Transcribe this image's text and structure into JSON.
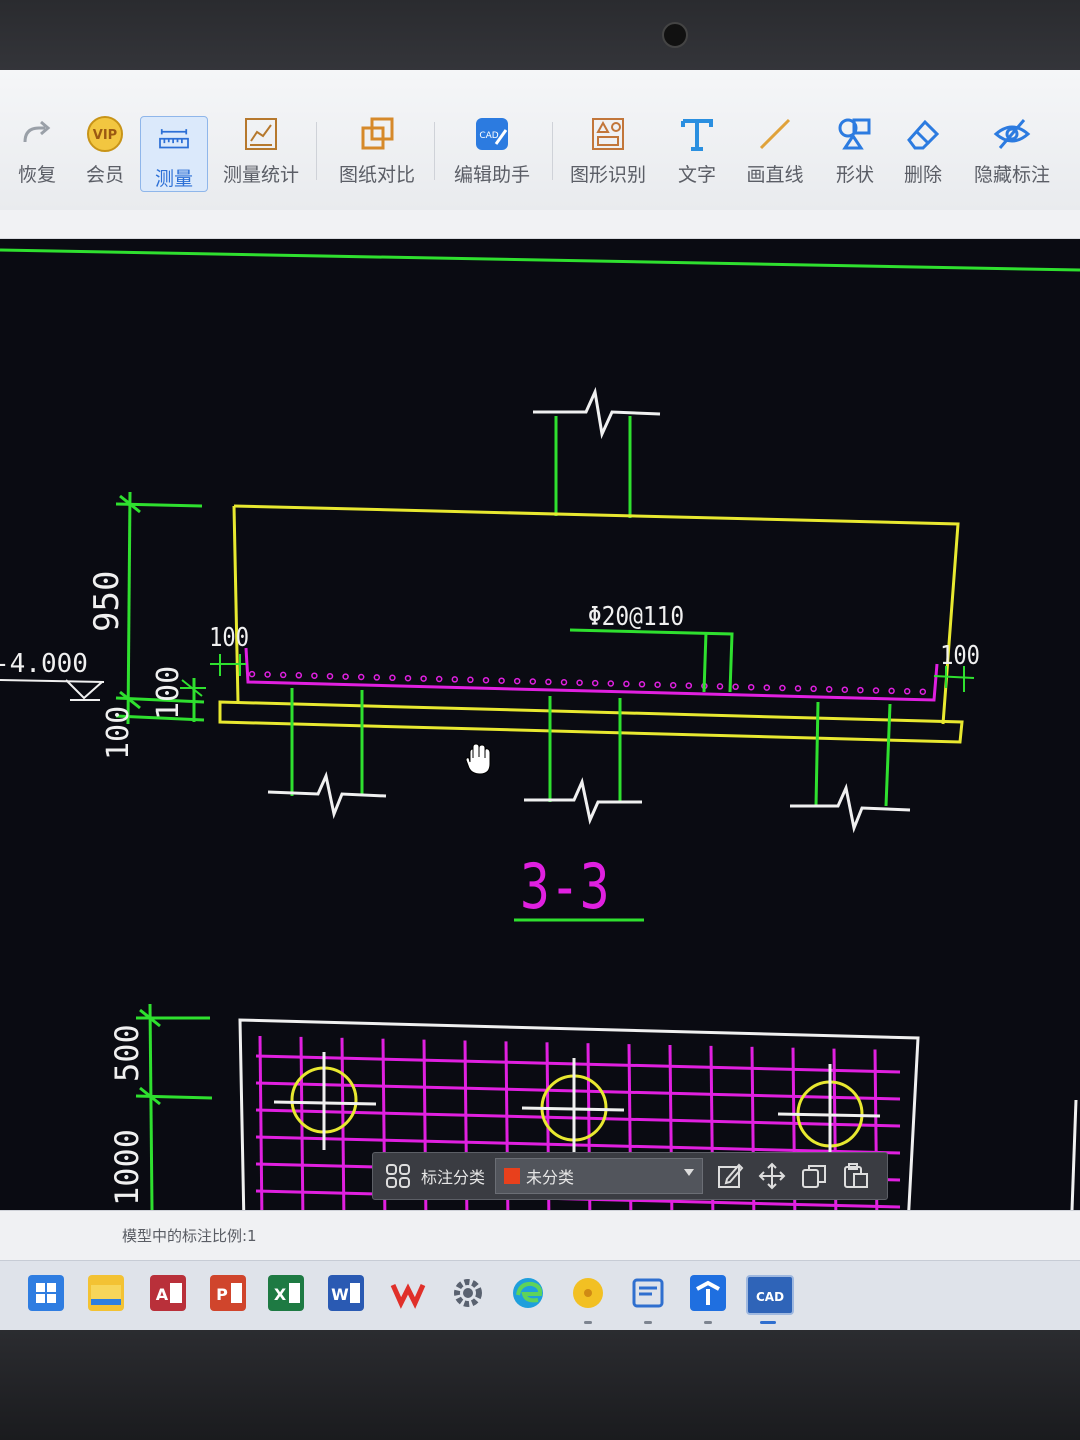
{
  "toolbar": {
    "items": [
      {
        "id": "redo",
        "label": "恢复",
        "icon": "redo-arrow-icon"
      },
      {
        "id": "vip",
        "label": "会员",
        "icon": "vip-badge-icon"
      },
      {
        "id": "measure",
        "label": "测量",
        "icon": "ruler-icon",
        "active": true
      },
      {
        "id": "measure-stats",
        "label": "测量统计",
        "icon": "chart-ruler-icon"
      },
      {
        "id": "compare",
        "label": "图纸对比",
        "icon": "overlap-squares-icon"
      },
      {
        "id": "edit-assistant",
        "label": "编辑助手",
        "icon": "cad-edit-icon"
      },
      {
        "id": "shape-recognition",
        "label": "图形识别",
        "icon": "shape-recognize-icon"
      },
      {
        "id": "text",
        "label": "文字",
        "icon": "text-t-icon"
      },
      {
        "id": "draw-line",
        "label": "画直线",
        "icon": "line-icon"
      },
      {
        "id": "shape",
        "label": "形状",
        "icon": "shapes-icon"
      },
      {
        "id": "delete",
        "label": "删除",
        "icon": "eraser-icon"
      },
      {
        "id": "hide-annotation",
        "label": "隐藏标注",
        "icon": "eye-hide-icon"
      }
    ]
  },
  "drawing": {
    "dim_950": "950",
    "dim_100_a": "100",
    "dim_100_b": "100",
    "dim_100_left": "100",
    "dim_100_right": "100",
    "elevation": "-4.000",
    "rebar_label": "Φ20@110",
    "section_title": "3-3",
    "dim_500": "500",
    "dim_1000": "1000"
  },
  "floatbar": {
    "label": "标注分类",
    "selected": "未分类",
    "swatch_color": "#e8401c"
  },
  "status": {
    "scale_text": "模型中的标注比例:1"
  },
  "taskbar": {
    "apps": [
      "start-icon",
      "file-explorer-icon",
      "access-icon",
      "powerpoint-icon",
      "excel-icon",
      "word-icon",
      "wps-icon",
      "settings-gear-icon",
      "edge-icon",
      "yellow-app-icon",
      "reader-app-icon",
      "blue-app-icon",
      "cad-app-icon"
    ]
  },
  "colors": {
    "cad_green": "#2fe02f",
    "cad_yellow": "#e8e830",
    "cad_magenta": "#e020e0",
    "cad_white": "#f0f0f0",
    "accent_blue": "#2c6fd6"
  }
}
